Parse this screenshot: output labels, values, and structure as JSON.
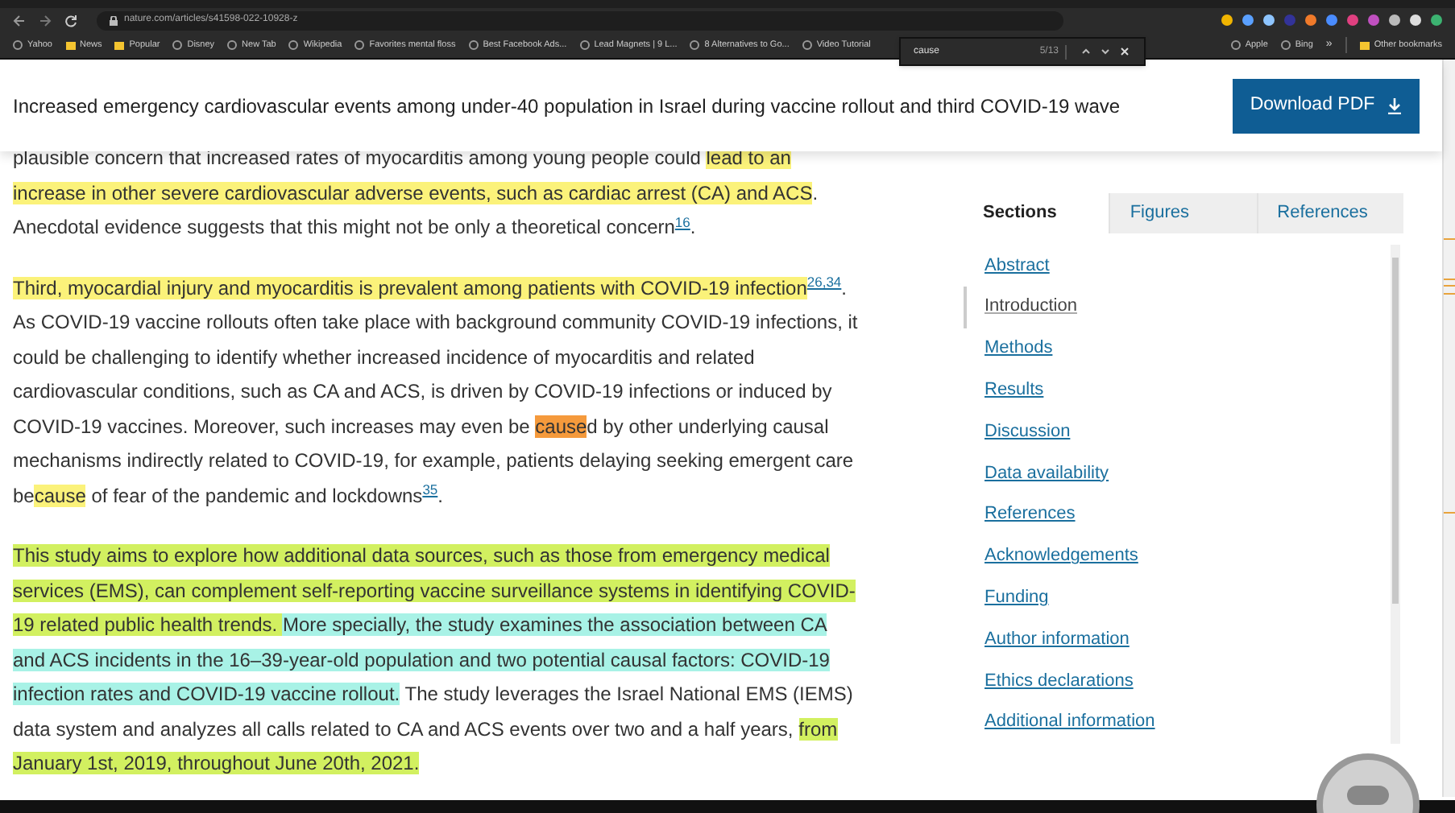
{
  "browser": {
    "url": "nature.com/articles/s41598-022-10928-z",
    "bookmarks": [
      {
        "label": "Yahoo",
        "kind": "site"
      },
      {
        "label": "News",
        "kind": "folder"
      },
      {
        "label": "Popular",
        "kind": "folder"
      },
      {
        "label": "Disney",
        "kind": "site"
      },
      {
        "label": "New Tab",
        "kind": "site"
      },
      {
        "label": "Wikipedia",
        "kind": "site"
      },
      {
        "label": "Favorites mental floss",
        "kind": "site"
      },
      {
        "label": "Best Facebook Ads...",
        "kind": "site"
      },
      {
        "label": "Lead Magnets | 9 L...",
        "kind": "site"
      },
      {
        "label": "8 Alternatives to Go...",
        "kind": "site"
      },
      {
        "label": "Video Tutorial",
        "kind": "site"
      }
    ],
    "bookmarks_right": [
      {
        "label": "Apple",
        "kind": "site"
      },
      {
        "label": "Bing",
        "kind": "site"
      },
      {
        "label": "»",
        "kind": "overflow"
      },
      {
        "label": "Other bookmarks",
        "kind": "folder"
      }
    ]
  },
  "find_bar": {
    "query": "cause",
    "count": "5/13"
  },
  "header": {
    "title": "Increased emergency cardiovascular events among under-40 population in Israel during vaccine rollout and third COVID-19 wave",
    "download_button": "Download PDF"
  },
  "paragraphs": [
    [
      {
        "kind": "plain",
        "text": "plausible concern that increased rates of myocarditis among young people could "
      },
      {
        "kind": "highlight",
        "color": "#fbf27a",
        "text": "lead to an increase in other severe cardiovascular adverse events, such as cardiac arrest (CA) and ACS"
      },
      {
        "kind": "plain",
        "text": ". Anecdotal evidence suggests that this might not be only a theoretical concern"
      },
      {
        "kind": "citation",
        "text": "16"
      },
      {
        "kind": "plain",
        "text": "."
      }
    ],
    [
      {
        "kind": "highlight",
        "color": "#fbf27a",
        "text": "Third, myocardial injury and myocarditis is prevalent among patients with COVID-19 infection"
      },
      {
        "kind": "citation",
        "text": "26,34"
      },
      {
        "kind": "plain",
        "text": ". As COVID-19 vaccine rollouts often take place with background community COVID-19 infections, it could be challenging to identify whether increased incidence of myocarditis and related cardiovascular conditions, such as CA and ACS, is driven by COVID-19 infections or induced by COVID-19 vaccines. Moreover, such increases may even be "
      },
      {
        "kind": "highlight",
        "color": "#f59a3c",
        "text": "cause"
      },
      {
        "kind": "plain",
        "text": "d by other underlying causal mechanisms indirectly related to COVID-19, for example, patients delaying seeking emergent care be"
      },
      {
        "kind": "highlight",
        "color": "#fbf27a",
        "text": "cause"
      },
      {
        "kind": "plain",
        "text": " of fear of the pandemic and lockdowns"
      },
      {
        "kind": "citation",
        "text": "35"
      },
      {
        "kind": "plain",
        "text": "."
      }
    ],
    [
      {
        "kind": "highlight",
        "color": "#d2f060",
        "text": "This study aims to explore how additional data sources, such as those from emergency medical services (EMS), can complement self-reporting vaccine surveillance systems in identifying COVID-19 related public health trends. "
      },
      {
        "kind": "highlight",
        "color": "#a8f2e6",
        "text": "More specially, the study examines the association between CA and ACS incidents in the 16–39-year-old population and two potential causal factors: COVID-19 infection rates and COVID-19 vaccine rollout."
      },
      {
        "kind": "plain",
        "text": " The study leverages the Israel National EMS (IEMS) data system and analyzes all calls related to CA and ACS events over two and a half years, "
      },
      {
        "kind": "highlight",
        "color": "#d2f060",
        "text": "from January 1st, 2019, throughout June 20th, 2021."
      }
    ]
  ],
  "sidebar": {
    "tabs": [
      {
        "label": "Sections",
        "selected": true
      },
      {
        "label": "Figures",
        "selected": false
      },
      {
        "label": "References",
        "selected": false
      }
    ],
    "items": [
      {
        "label": "Abstract",
        "selected": false
      },
      {
        "label": "Introduction",
        "selected": true
      },
      {
        "label": "Methods",
        "selected": false
      },
      {
        "label": "Results",
        "selected": false
      },
      {
        "label": "Discussion",
        "selected": false
      },
      {
        "label": "Data availability",
        "selected": false
      },
      {
        "label": "References",
        "selected": false
      },
      {
        "label": "Acknowledgements",
        "selected": false
      },
      {
        "label": "Funding",
        "selected": false
      },
      {
        "label": "Author information",
        "selected": false
      },
      {
        "label": "Ethics declarations",
        "selected": false
      },
      {
        "label": "Additional information",
        "selected": false
      }
    ]
  }
}
